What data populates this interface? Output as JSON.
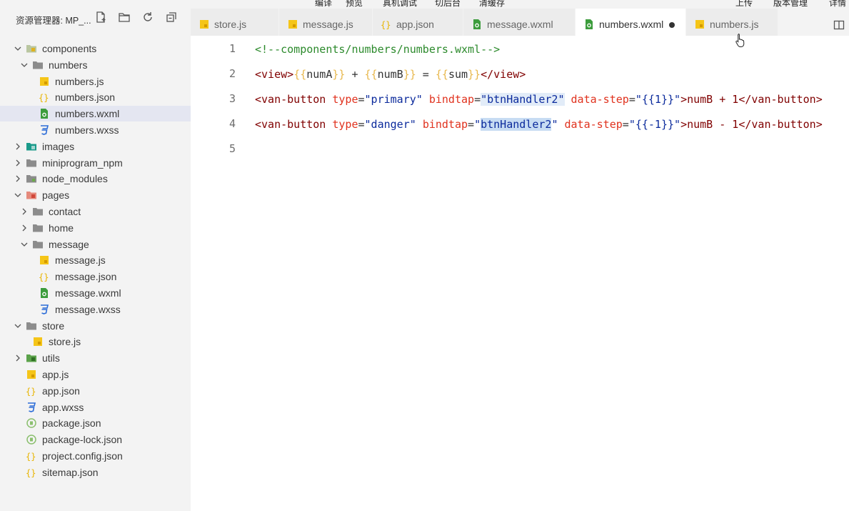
{
  "toolbar": {
    "items": [
      "编译",
      "预览",
      "真机调试",
      "切后台",
      "清缓存"
    ],
    "right_items": [
      "上传",
      "版本管理",
      "详情"
    ]
  },
  "sidebar": {
    "title": "资源管理器: MP_...",
    "header_icons": [
      "new-file-icon",
      "new-folder-icon",
      "refresh-icon",
      "collapse-all-icon"
    ],
    "tree": [
      {
        "label": "components",
        "icon": "folder-components-icon",
        "depth": 0,
        "expanded": true
      },
      {
        "label": "numbers",
        "icon": "folder-icon",
        "depth": 1,
        "expanded": true
      },
      {
        "label": "numbers.js",
        "icon": "js-file-icon",
        "depth": 2
      },
      {
        "label": "numbers.json",
        "icon": "json-file-icon",
        "depth": 2
      },
      {
        "label": "numbers.wxml",
        "icon": "wxml-file-icon",
        "depth": 2,
        "selected": true
      },
      {
        "label": "numbers.wxss",
        "icon": "wxss-file-icon",
        "depth": 2
      },
      {
        "label": "images",
        "icon": "folder-images-icon",
        "depth": 0,
        "expanded": false
      },
      {
        "label": "miniprogram_npm",
        "icon": "folder-icon",
        "depth": 0,
        "expanded": false
      },
      {
        "label": "node_modules",
        "icon": "folder-node-icon",
        "depth": 0,
        "expanded": false
      },
      {
        "label": "pages",
        "icon": "folder-pages-icon",
        "depth": 0,
        "expanded": true
      },
      {
        "label": "contact",
        "icon": "folder-icon",
        "depth": 1,
        "expanded": false
      },
      {
        "label": "home",
        "icon": "folder-icon",
        "depth": 1,
        "expanded": false
      },
      {
        "label": "message",
        "icon": "folder-icon",
        "depth": 1,
        "expanded": true
      },
      {
        "label": "message.js",
        "icon": "js-file-icon",
        "depth": 2
      },
      {
        "label": "message.json",
        "icon": "json-file-icon",
        "depth": 2
      },
      {
        "label": "message.wxml",
        "icon": "wxml-file-icon",
        "depth": 2
      },
      {
        "label": "message.wxss",
        "icon": "wxss-file-icon",
        "depth": 2
      },
      {
        "label": "store",
        "icon": "folder-icon",
        "depth": 0,
        "expanded": true
      },
      {
        "label": "store.js",
        "icon": "js-file-icon",
        "depth": 1
      },
      {
        "label": "utils",
        "icon": "folder-utils-icon",
        "depth": 0,
        "expanded": false
      },
      {
        "label": "app.js",
        "icon": "js-file-icon",
        "depth": 0
      },
      {
        "label": "app.json",
        "icon": "json-file-icon",
        "depth": 0
      },
      {
        "label": "app.wxss",
        "icon": "wxss-file-icon",
        "depth": 0
      },
      {
        "label": "package.json",
        "icon": "npm-file-icon",
        "depth": 0
      },
      {
        "label": "package-lock.json",
        "icon": "npm-file-icon",
        "depth": 0
      },
      {
        "label": "project.config.json",
        "icon": "json-file-icon",
        "depth": 0
      },
      {
        "label": "sitemap.json",
        "icon": "json-file-icon",
        "depth": 0
      }
    ]
  },
  "tabs": [
    {
      "label": "store.js",
      "icon": "js-file-icon"
    },
    {
      "label": "message.js",
      "icon": "js-file-icon"
    },
    {
      "label": "app.json",
      "icon": "json-file-icon"
    },
    {
      "label": "message.wxml",
      "icon": "wxml-file-icon"
    },
    {
      "label": "numbers.wxml",
      "icon": "wxml-file-icon",
      "active": true,
      "modified": true
    },
    {
      "label": "numbers.js",
      "icon": "js-file-icon"
    }
  ],
  "editor": {
    "line_numbers": [
      "1",
      "2",
      "3",
      "4",
      "5"
    ],
    "lines": [
      [
        {
          "t": "<!--components/numbers/numbers.wxml-->",
          "c": "comment"
        }
      ],
      [
        {
          "t": "<view>",
          "c": "tag"
        },
        {
          "t": "{{",
          "c": "brace"
        },
        {
          "t": "numA",
          "c": "var"
        },
        {
          "t": "}}",
          "c": "brace"
        },
        {
          "t": " + ",
          "c": "var"
        },
        {
          "t": "{{",
          "c": "brace"
        },
        {
          "t": "numB",
          "c": "var"
        },
        {
          "t": "}}",
          "c": "brace"
        },
        {
          "t": " = ",
          "c": "var"
        },
        {
          "t": "{{",
          "c": "brace"
        },
        {
          "t": "sum",
          "c": "var"
        },
        {
          "t": "}}",
          "c": "brace"
        },
        {
          "t": "</view>",
          "c": "tag"
        }
      ],
      [
        {
          "t": "<van-button ",
          "c": "tag"
        },
        {
          "t": "type",
          "c": "attr"
        },
        {
          "t": "=",
          "c": "var"
        },
        {
          "t": "\"primary\"",
          "c": "str"
        },
        {
          "t": " ",
          "c": "var"
        },
        {
          "t": "bindtap",
          "c": "attr"
        },
        {
          "t": "=",
          "c": "var"
        },
        {
          "t": "\"btnHandler2\"",
          "c": "str",
          "hl": "soft"
        },
        {
          "t": " ",
          "c": "var"
        },
        {
          "t": "data-step",
          "c": "attr"
        },
        {
          "t": "=",
          "c": "var"
        },
        {
          "t": "\"{{1}}\"",
          "c": "str"
        },
        {
          "t": ">numB + 1</van-button>",
          "c": "tag"
        }
      ],
      [
        {
          "t": "<van-button ",
          "c": "tag"
        },
        {
          "t": "type",
          "c": "attr"
        },
        {
          "t": "=",
          "c": "var"
        },
        {
          "t": "\"danger\"",
          "c": "str"
        },
        {
          "t": " ",
          "c": "var"
        },
        {
          "t": "bindtap",
          "c": "attr"
        },
        {
          "t": "=",
          "c": "var"
        },
        {
          "t": "\"",
          "c": "str"
        },
        {
          "t": "btnHandler2",
          "c": "str",
          "hl": "strong"
        },
        {
          "t": "\"",
          "c": "str"
        },
        {
          "t": " ",
          "c": "var"
        },
        {
          "t": "data-step",
          "c": "attr"
        },
        {
          "t": "=",
          "c": "var"
        },
        {
          "t": "\"{{-1}}\"",
          "c": "str"
        },
        {
          "t": ">numB - 1</van-button>",
          "c": "tag"
        }
      ],
      []
    ]
  },
  "colors": {
    "sidebar_bg": "#f3f3f3",
    "selected_row": "#e4e6f1",
    "comment": "#2c8a2c",
    "tag": "#800000",
    "attr": "#e0321e",
    "string": "#0b2a9c",
    "brace": "#e8b84d"
  }
}
